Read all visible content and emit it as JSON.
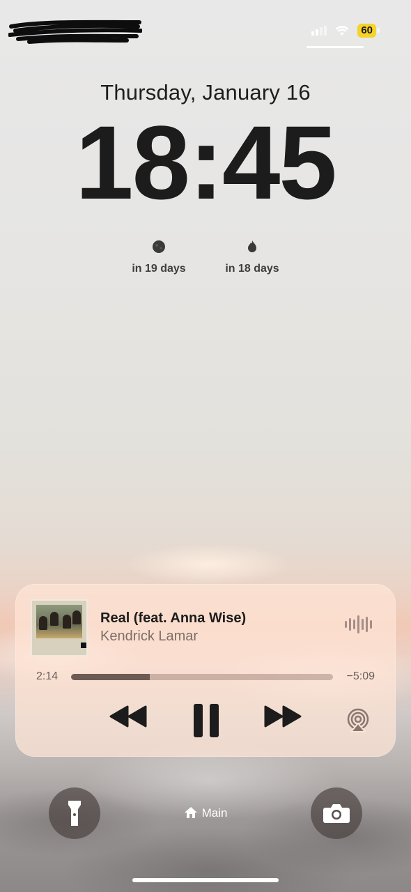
{
  "status_bar": {
    "battery_level": "60",
    "battery_color": "#f5d328",
    "signal_icon": "cellular-signal-icon",
    "wifi_icon": "wifi-icon"
  },
  "lock_screen": {
    "date": "Thursday, January 16",
    "time": "18:45"
  },
  "widgets": [
    {
      "icon": "moon-icon",
      "label": "in 19 days"
    },
    {
      "icon": "flame-icon",
      "label": "in 18 days"
    }
  ],
  "now_playing": {
    "title": "Real (feat. Anna Wise)",
    "artist": "Kendrick Lamar",
    "elapsed": "2:14",
    "remaining": "−5:09",
    "progress": 0.3,
    "accent_color": "#6d5a55",
    "controls": [
      "rewind-icon",
      "pause-icon",
      "fast-forward-icon",
      "airplay-icon"
    ]
  },
  "bottom": {
    "focus_label": "Main",
    "left_button": "flashlight-icon",
    "right_button": "camera-icon"
  }
}
